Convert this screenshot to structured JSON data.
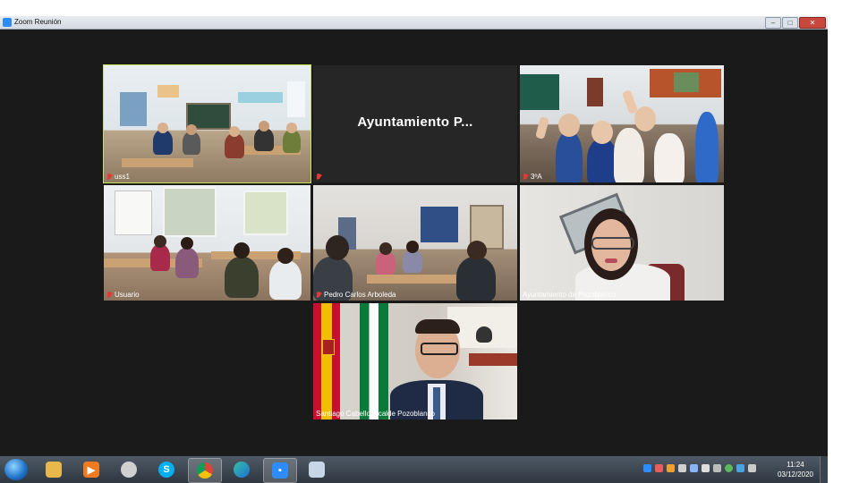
{
  "window": {
    "title": "Zoom Reunión",
    "controls": [
      "minimize",
      "maximize",
      "close"
    ]
  },
  "tiles": [
    {
      "name": "uss1",
      "muted": true,
      "active_speaker": true,
      "scene": "classroom"
    },
    {
      "name": "Ayuntamiento P...",
      "muted": true,
      "video": false,
      "display_name": "Ayuntamiento  P..."
    },
    {
      "name": "3ºA",
      "muted": true,
      "scene": "classroom"
    },
    {
      "name": "Usuario",
      "muted": true,
      "scene": "classroom"
    },
    {
      "name": "Pedro Carlos Arboleda",
      "muted": true,
      "scene": "classroom"
    },
    {
      "name": "Ayuntamiento de Pozoblanco",
      "muted": false,
      "scene": "person"
    },
    {
      "name": "Santiago Cabello Alcalde Pozoblanco",
      "muted": false,
      "scene": "person"
    }
  ],
  "taskbar": {
    "apps": [
      {
        "icon": "file-explorer-icon"
      },
      {
        "icon": "media-player-icon"
      },
      {
        "icon": "obs-icon"
      },
      {
        "icon": "skype-icon"
      },
      {
        "icon": "chrome-icon"
      },
      {
        "icon": "edge-icon"
      },
      {
        "icon": "zoom-icon"
      },
      {
        "icon": "paint-icon"
      }
    ],
    "clock": {
      "time": "11:24",
      "date": "03/12/2020"
    }
  },
  "colors": {
    "active_speaker_border": "#c7e35a",
    "zoom_blue": "#2d8cff",
    "mute_red": "#e53935"
  }
}
